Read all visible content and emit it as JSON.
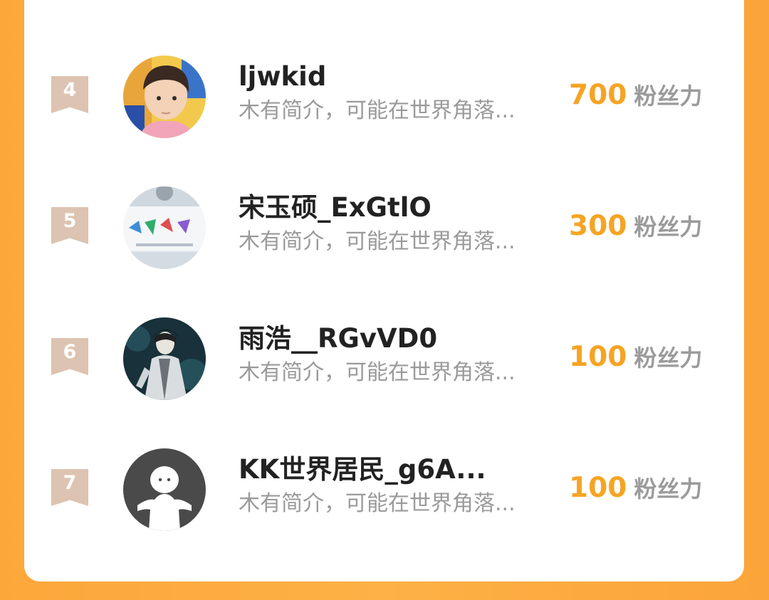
{
  "leaderboard": {
    "rows": [
      {
        "rank": "4",
        "name": "ljwkid",
        "bio": "木有简介，可能在世界角落...",
        "fans": "700",
        "unit": "粉丝力",
        "avatar": "child-photo"
      },
      {
        "rank": "5",
        "name": "宋玉硕_ExGtlO",
        "bio": "木有简介，可能在世界角落...",
        "fans": "300",
        "unit": "粉丝力",
        "avatar": "youth-banner-photo"
      },
      {
        "rank": "6",
        "name": "雨浩__RGvVD0",
        "bio": "木有简介，可能在世界角落...",
        "fans": "100",
        "unit": "粉丝力",
        "avatar": "anime-character"
      },
      {
        "rank": "7",
        "name": "KK世界居民_g6A...",
        "bio": "木有简介，可能在世界角落...",
        "fans": "100",
        "unit": "粉丝力",
        "avatar": "default-user-icon"
      }
    ]
  },
  "colors": {
    "background": "#fca73a",
    "card": "#ffffff",
    "fans_value": "#f5a424",
    "rank_badge": "#ddc3b1",
    "name": "#222222",
    "bio": "#9a9a9a"
  }
}
